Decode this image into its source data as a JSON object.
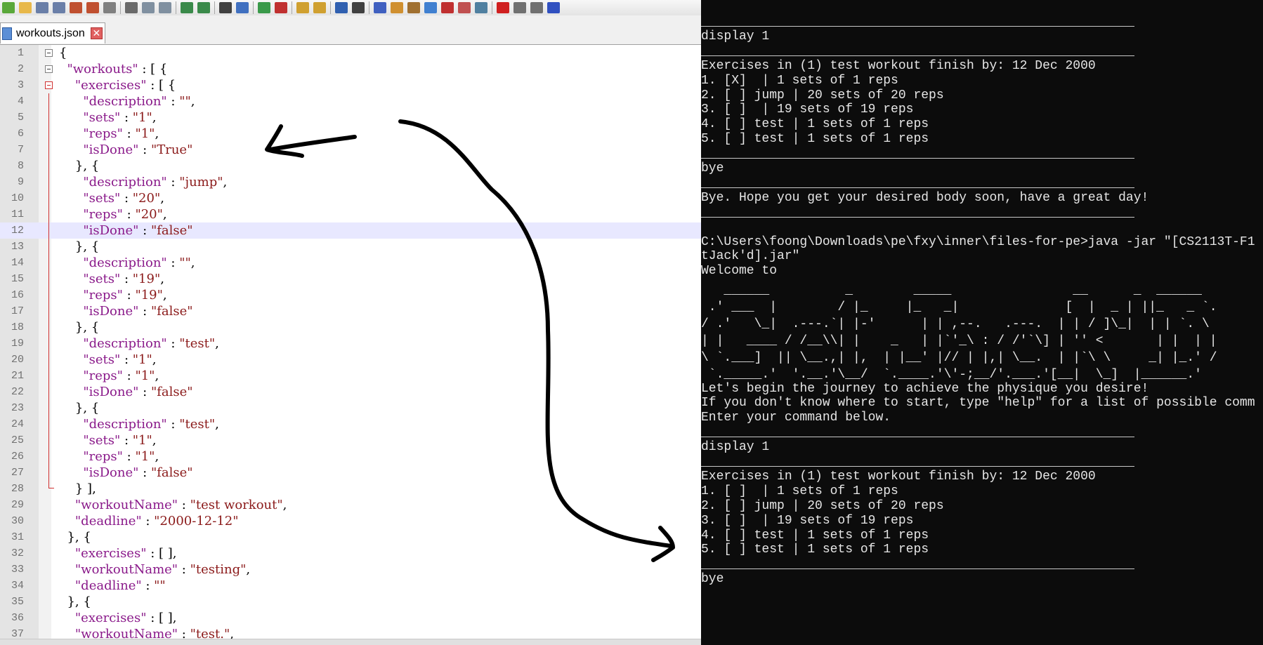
{
  "editor": {
    "tab_label": "workouts.json",
    "tab_close": "✕",
    "lines": [
      {
        "n": "1",
        "t": "{",
        "fold": "open"
      },
      {
        "n": "2",
        "t": "  \"workouts\" : [ {",
        "fold": "open"
      },
      {
        "n": "3",
        "t": "    \"exercises\" : [ {",
        "fold": "red"
      },
      {
        "n": "4",
        "t": "      \"description\" : \"\","
      },
      {
        "n": "5",
        "t": "      \"sets\" : \"1\","
      },
      {
        "n": "6",
        "t": "      \"reps\" : \"1\","
      },
      {
        "n": "7",
        "t": "      \"isDone\" : \"True\""
      },
      {
        "n": "8",
        "t": "    }, {"
      },
      {
        "n": "9",
        "t": "      \"description\" : \"jump\","
      },
      {
        "n": "10",
        "t": "      \"sets\" : \"20\","
      },
      {
        "n": "11",
        "t": "      \"reps\" : \"20\","
      },
      {
        "n": "12",
        "t": "      \"isDone\" : \"false\"",
        "current": true
      },
      {
        "n": "13",
        "t": "    }, {"
      },
      {
        "n": "14",
        "t": "      \"description\" : \"\","
      },
      {
        "n": "15",
        "t": "      \"sets\" : \"19\","
      },
      {
        "n": "16",
        "t": "      \"reps\" : \"19\","
      },
      {
        "n": "17",
        "t": "      \"isDone\" : \"false\""
      },
      {
        "n": "18",
        "t": "    }, {"
      },
      {
        "n": "19",
        "t": "      \"description\" : \"test\","
      },
      {
        "n": "20",
        "t": "      \"sets\" : \"1\","
      },
      {
        "n": "21",
        "t": "      \"reps\" : \"1\","
      },
      {
        "n": "22",
        "t": "      \"isDone\" : \"false\""
      },
      {
        "n": "23",
        "t": "    }, {"
      },
      {
        "n": "24",
        "t": "      \"description\" : \"test\","
      },
      {
        "n": "25",
        "t": "      \"sets\" : \"1\","
      },
      {
        "n": "26",
        "t": "      \"reps\" : \"1\","
      },
      {
        "n": "27",
        "t": "      \"isDone\" : \"false\""
      },
      {
        "n": "28",
        "t": "    } ],",
        "foldend": true
      },
      {
        "n": "29",
        "t": "    \"workoutName\" : \"test workout\","
      },
      {
        "n": "30",
        "t": "    \"deadline\" : \"2000-12-12\""
      },
      {
        "n": "31",
        "t": "  }, {"
      },
      {
        "n": "32",
        "t": "    \"exercises\" : [ ],"
      },
      {
        "n": "33",
        "t": "    \"workoutName\" : \"testing\","
      },
      {
        "n": "34",
        "t": "    \"deadline\" : \"\""
      },
      {
        "n": "35",
        "t": "  }, {"
      },
      {
        "n": "36",
        "t": "    \"exercises\" : [ ],"
      },
      {
        "n": "37",
        "t": "    \"workoutName\" : \"test.\","
      }
    ]
  },
  "terminal": {
    "lines": [
      {
        "t": "display 1",
        "row": 1
      },
      {
        "t": "Exercises in (1) test workout finish by: 12 Dec 2000",
        "row": 3
      },
      {
        "t": "1. [X]  | 1 sets of 1 reps",
        "row": 4
      },
      {
        "t": "2. [ ] jump | 20 sets of 20 reps",
        "row": 5
      },
      {
        "t": "3. [ ]  | 19 sets of 19 reps",
        "row": 6
      },
      {
        "t": "4. [ ] test | 1 sets of 1 reps",
        "row": 7
      },
      {
        "t": "5. [ ] test | 1 sets of 1 reps",
        "row": 8
      },
      {
        "t": "bye",
        "row": 10
      },
      {
        "t": "Bye. Hope you get your desired body soon, have a great day!",
        "row": 12
      },
      {
        "t": "C:\\Users\\foong\\Downloads\\pe\\fxy\\inner\\files-for-pe>java -jar \"[CS2113T-F1",
        "row": 15
      },
      {
        "t": "tJack'd].jar\"",
        "row": 16
      },
      {
        "t": "Welcome to",
        "row": 17
      },
      {
        "t": "Let's begin the journey to achieve the physique you desire!",
        "row": 25
      },
      {
        "t": "If you don't know where to start, type \"help\" for a list of possible comm",
        "row": 26
      },
      {
        "t": "Enter your command below.",
        "row": 27
      },
      {
        "t": "display 1",
        "row": 29
      },
      {
        "t": "Exercises in (1) test workout finish by: 12 Dec 2000",
        "row": 31
      },
      {
        "t": "1. [ ]  | 1 sets of 1 reps",
        "row": 32
      },
      {
        "t": "2. [ ] jump | 20 sets of 20 reps",
        "row": 33
      },
      {
        "t": "3. [ ]  | 19 sets of 19 reps",
        "row": 34
      },
      {
        "t": "4. [ ] test | 1 sets of 1 reps",
        "row": 35
      },
      {
        "t": "5. [ ] test | 1 sets of 1 reps",
        "row": 36
      },
      {
        "t": "bye",
        "row": 38
      }
    ],
    "separators_rows": [
      0,
      2,
      9,
      11,
      13,
      28,
      30,
      37
    ],
    "ascii_banner": "   ______          _        _____                __      _  ______\n .' ___  |        / |_     |_   _|              [  |  _ | ||_   _ `.\n/ .'   \\_|  .---.`| |-'      | | ,--.   .---.  | | / ]\\_|  | | `. \\\n| |   ____ / /__\\\\| |    _   | |`'_\\ : / /'`\\] | '' <       | |  | |\n\\ `.___]  || \\__.,| |,  | |__' |// | |,| \\__.  | |`\\ \\     _| |_.' /\n `._____.'  '.__.'\\__/  `.____.'\\'-;__/'.___.'[__|  \\_]  |______.'"
  }
}
